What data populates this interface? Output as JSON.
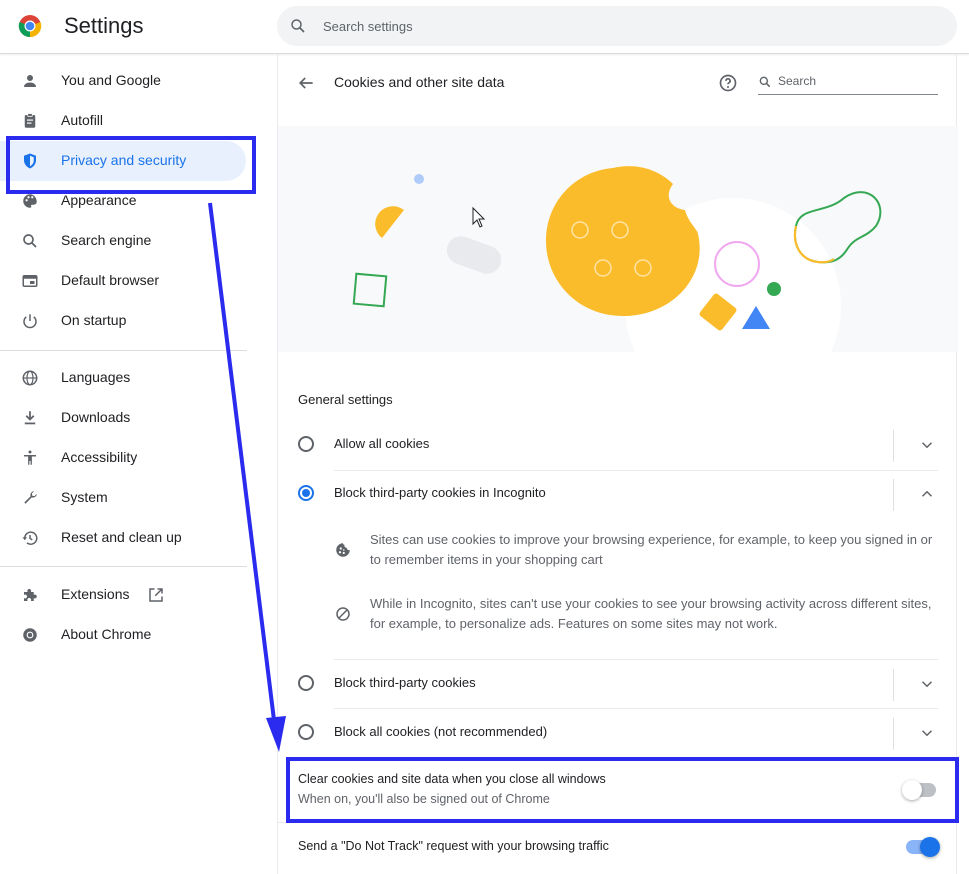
{
  "app": {
    "title": "Settings"
  },
  "search": {
    "placeholder": "Search settings"
  },
  "sidebar": {
    "items": [
      {
        "label": "You and Google",
        "icon": "person-icon"
      },
      {
        "label": "Autofill",
        "icon": "clipboard-icon"
      },
      {
        "label": "Privacy and security",
        "icon": "shield-icon",
        "active": true
      },
      {
        "label": "Appearance",
        "icon": "palette-icon"
      },
      {
        "label": "Search engine",
        "icon": "search-icon"
      },
      {
        "label": "Default browser",
        "icon": "browser-window-icon"
      },
      {
        "label": "On startup",
        "icon": "power-icon"
      },
      {
        "label": "Languages",
        "icon": "globe-icon"
      },
      {
        "label": "Downloads",
        "icon": "download-icon"
      },
      {
        "label": "Accessibility",
        "icon": "accessibility-icon"
      },
      {
        "label": "System",
        "icon": "wrench-icon"
      },
      {
        "label": "Reset and clean up",
        "icon": "history-icon"
      },
      {
        "label": "Extensions",
        "icon": "puzzle-icon"
      },
      {
        "label": "About Chrome",
        "icon": "chrome-icon"
      }
    ]
  },
  "page": {
    "title": "Cookies and other site data",
    "search_label": "Search",
    "section_title": "General settings",
    "options": [
      {
        "label": "Allow all cookies",
        "selected": false,
        "expanded": false
      },
      {
        "label": "Block third-party cookies in Incognito",
        "selected": true,
        "expanded": true
      },
      {
        "label": "Block third-party cookies",
        "selected": false,
        "expanded": false
      },
      {
        "label": "Block all cookies (not recommended)",
        "selected": false,
        "expanded": false
      }
    ],
    "details": [
      {
        "icon": "cookie-icon",
        "text": "Sites can use cookies to improve your browsing experience, for example, to keep you signed in or to remember items in your shopping cart"
      },
      {
        "icon": "block-icon",
        "text": "While in Incognito, sites can't use your cookies to see your browsing activity across different sites, for example, to personalize ads. Features on some sites may not work."
      }
    ],
    "toggles": [
      {
        "title": "Clear cookies and site data when you close all windows",
        "subtitle": "When on, you'll also be signed out of Chrome",
        "on": false
      },
      {
        "title": "Send a \"Do Not Track\" request with your browsing traffic",
        "on": true
      }
    ]
  },
  "colors": {
    "accent": "#1a73e8",
    "annotation": "#2b2bf0",
    "active_bg": "#e8f0fe"
  }
}
